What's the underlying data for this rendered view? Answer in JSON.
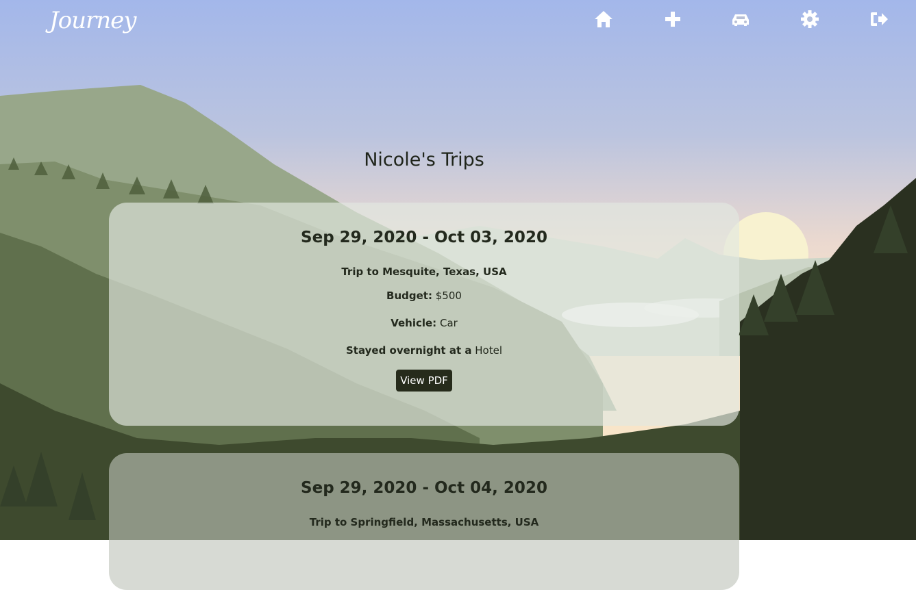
{
  "brand": {
    "name": "Journey"
  },
  "nav": {
    "items": [
      {
        "name": "home",
        "icon": "home-icon"
      },
      {
        "name": "add-trip",
        "icon": "plus-icon"
      },
      {
        "name": "vehicles",
        "icon": "car-icon"
      },
      {
        "name": "settings",
        "icon": "gear-icon"
      },
      {
        "name": "logout",
        "icon": "sign-out-icon"
      }
    ],
    "icon_color": "#ffffff"
  },
  "page": {
    "title": "Nicole's Trips"
  },
  "labels": {
    "budget": "Budget:",
    "vehicle": "Vehicle:",
    "stayed": "Stayed overnight at a",
    "view_pdf": "View PDF"
  },
  "trips": [
    {
      "dates": "Sep 29, 2020 - Oct 03, 2020",
      "destination": "Trip to Mesquite, Texas, USA",
      "budget": "$500",
      "vehicle": "Car",
      "lodging": "Hotel"
    },
    {
      "dates": "Sep 29, 2020 - Oct 04, 2020",
      "destination": "Trip to Springfield, Massachusetts, USA"
    }
  ],
  "colors": {
    "sky_top": "#a4b8e8",
    "sky_bottom": "#f2ddc6",
    "sun": "#f8f1cf",
    "forest_dark": "#2a3020",
    "button_bg": "#262b1b"
  }
}
